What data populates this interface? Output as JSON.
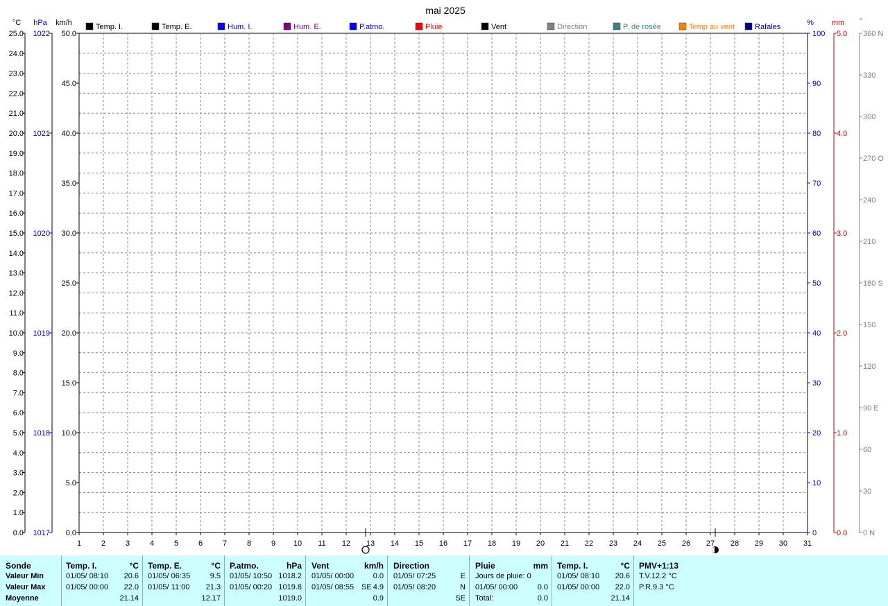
{
  "chart_data": {
    "type": "line",
    "title": "mai 2025",
    "x_ticks": [
      1,
      2,
      3,
      4,
      5,
      6,
      7,
      8,
      9,
      10,
      11,
      12,
      13,
      14,
      15,
      16,
      17,
      18,
      19,
      20,
      21,
      22,
      23,
      24,
      25,
      26,
      27,
      28,
      29,
      30,
      31
    ],
    "xlim": [
      1,
      31
    ],
    "axes": {
      "temp": {
        "unit": "°C",
        "ylim": [
          0,
          25
        ],
        "ticks": [
          "0.0",
          "1.0",
          "2.0",
          "3.0",
          "4.0",
          "5.0",
          "6.0",
          "7.0",
          "8.0",
          "9.0",
          "10.0",
          "11.0",
          "12.0",
          "13.0",
          "14.0",
          "15.0",
          "16.0",
          "17.0",
          "18.0",
          "19.0",
          "20.0",
          "21.0",
          "22.0",
          "23.0",
          "24.0",
          "25.0"
        ]
      },
      "pressure": {
        "unit": "hPa",
        "ylim": [
          1017,
          1022
        ],
        "ticks": [
          "1017",
          "1018",
          "1019",
          "1020",
          "1021",
          "1022"
        ]
      },
      "wind": {
        "unit": "km/h",
        "ylim": [
          0,
          50
        ],
        "ticks": [
          "0.0",
          "5.0",
          "10.0",
          "15.0",
          "20.0",
          "25.0",
          "30.0",
          "35.0",
          "40.0",
          "45.0",
          "50.0"
        ]
      },
      "humidity": {
        "unit": "%",
        "ylim": [
          0,
          100
        ],
        "ticks": [
          "0",
          "10",
          "20",
          "30",
          "40",
          "50",
          "60",
          "70",
          "80",
          "90",
          "100"
        ]
      },
      "rain": {
        "unit": "mm",
        "ylim": [
          0,
          5
        ],
        "ticks": [
          "0.0",
          "1.0",
          "2.0",
          "3.0",
          "4.0",
          "5.0"
        ]
      },
      "direction": {
        "unit": "°",
        "ylim": [
          0,
          360
        ],
        "ticks": [
          "0   N",
          "30",
          "60",
          "90   E",
          "120",
          "150",
          "180 S",
          "210",
          "240",
          "270 O",
          "300",
          "330",
          "360 N"
        ]
      }
    },
    "legend": [
      {
        "label": "Temp. I.",
        "color": "#000000"
      },
      {
        "label": "Temp. E.",
        "color": "#000000"
      },
      {
        "label": "Hum. I.",
        "color": "#0000ff"
      },
      {
        "label": "Hum. E.",
        "color": "#800080"
      },
      {
        "label": "P.atmo.",
        "color": "#0000ff"
      },
      {
        "label": "Pluie",
        "color": "#ff0000"
      },
      {
        "label": "Vent",
        "color": "#000000"
      },
      {
        "label": "Direction",
        "color": "#808080"
      },
      {
        "label": "P. de rosée",
        "color": "#408080"
      },
      {
        "label": "Temp au vent",
        "color": "#ff8000"
      },
      {
        "label": "Rafales",
        "color": "#000080"
      }
    ],
    "moon_phases": [
      {
        "day": 12.8,
        "phase": "full-moon"
      },
      {
        "day": 27.2,
        "phase": "new-moon"
      }
    ],
    "grid": true,
    "series": []
  },
  "colors": {
    "temp_axis": "#000000",
    "pressure_axis": "#0000c0",
    "humidity_axis": "#0000c0",
    "rain_axis": "#c00000",
    "direction_axis": "#808080",
    "panel_bg": "#ccffff"
  },
  "summary": {
    "labels": {
      "title": "Sonde",
      "min": "Valeur Min",
      "max": "Valeur Max",
      "avg": "Moyenne"
    },
    "temp_i": {
      "title": "Temp. I.",
      "unit": "°C",
      "min_date": "01/05/  08:10",
      "min": "20.6",
      "max_date": "01/05/  00:00",
      "max": "22.0",
      "avg": "21.14"
    },
    "temp_e": {
      "title": "Temp. E.",
      "unit": "°C",
      "min_date": "01/05/  06:35",
      "min": "9.5",
      "max_date": "01/05/  11:00",
      "max": "21.3",
      "avg": "12.17"
    },
    "patmo": {
      "title": "P.atmo.",
      "unit": "hPa",
      "min_date": "01/05/  10:50",
      "min": "1018.2",
      "max_date": "01/05/  00:20",
      "max": "1019.8",
      "avg": "1019.0"
    },
    "vent": {
      "title": "Vent",
      "unit": "km/h",
      "min_date": "01/05/  00:00",
      "min": "0.0",
      "max_date": "01/05/  08:55",
      "max_dir": "SE",
      "max": "4.9",
      "avg": "0.9"
    },
    "direction": {
      "title": "Direction",
      "min_date": "01/05/  07:25",
      "min": "E",
      "max_date": "01/05/  08:20",
      "max": "N",
      "avg": "SE"
    },
    "pluie": {
      "title": "Pluie",
      "unit": "mm",
      "days_label": "Jours de pluie: 0",
      "max_date": "01/05/  00:00",
      "max": "0.0",
      "total_label": "Total:",
      "total": "0.0"
    },
    "temp_i2": {
      "title": "Temp. I.",
      "unit": "°C",
      "min_date": "01/05/  08:10",
      "min": "20.6",
      "max_date": "01/05/  00:00",
      "max": "22.0",
      "avg": "21.14"
    },
    "pmv": {
      "title": "PMV+1:13",
      "line1": "T.V.12.2 °C",
      "line2": "P.R.9.3 °C"
    }
  }
}
